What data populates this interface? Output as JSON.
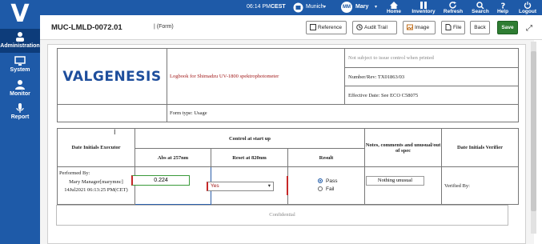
{
  "topbar": {
    "time": "06:14 PM",
    "timezone": "CEST",
    "site": "Munich",
    "user_initials": "MM",
    "user_name": "Mary",
    "buttons": [
      "Home",
      "Inventory",
      "Refresh",
      "Search",
      "Help",
      "Logout"
    ]
  },
  "sidebar": {
    "items": [
      "Administration",
      "System",
      "Monitor",
      "Report"
    ]
  },
  "header": {
    "doc_id": "MUC-LMLD-0072.01",
    "doc_type": "| (Form)",
    "buttons": {
      "reference": "Reference",
      "audit_trail": "Audit Trail",
      "image": "Image",
      "file": "File",
      "back": "Back",
      "save": "Save"
    }
  },
  "form_header": {
    "logo_text": "VALGENESIS",
    "logbook_title": "Logbook for Shimadzu UV-1800 spektrophotometer",
    "not_subject": "Not subject to issue control when printed",
    "number_rev": "Number/Rev: TX01863/03",
    "effective_date": "Effective Date: See ECO C58075",
    "form_type": "Form type: Usage"
  },
  "usage_table": {
    "col_date_exec": "Date Initials Executor",
    "control_header": "Control at start up",
    "col_abs": "Abs at 257nm",
    "col_reset": "Reset at 820nm",
    "col_result": "Result",
    "col_notes": "Notes, comments and unusual/out of spec",
    "col_verifier": "Date Initials Verifier",
    "performed_by": "Performed By:",
    "executor_name": "Mary Manager[marymnc]",
    "executor_date": "14Jul2021 06:13:25 PM(CET)",
    "abs_value": "0.224",
    "reset_value": "Yes",
    "result_options": [
      "Pass",
      "Fail"
    ],
    "result_selected": "Pass",
    "notes_value": "Nothing unusual",
    "verified_by": "Verified By:"
  },
  "footer": {
    "confidential": "Confidential"
  }
}
